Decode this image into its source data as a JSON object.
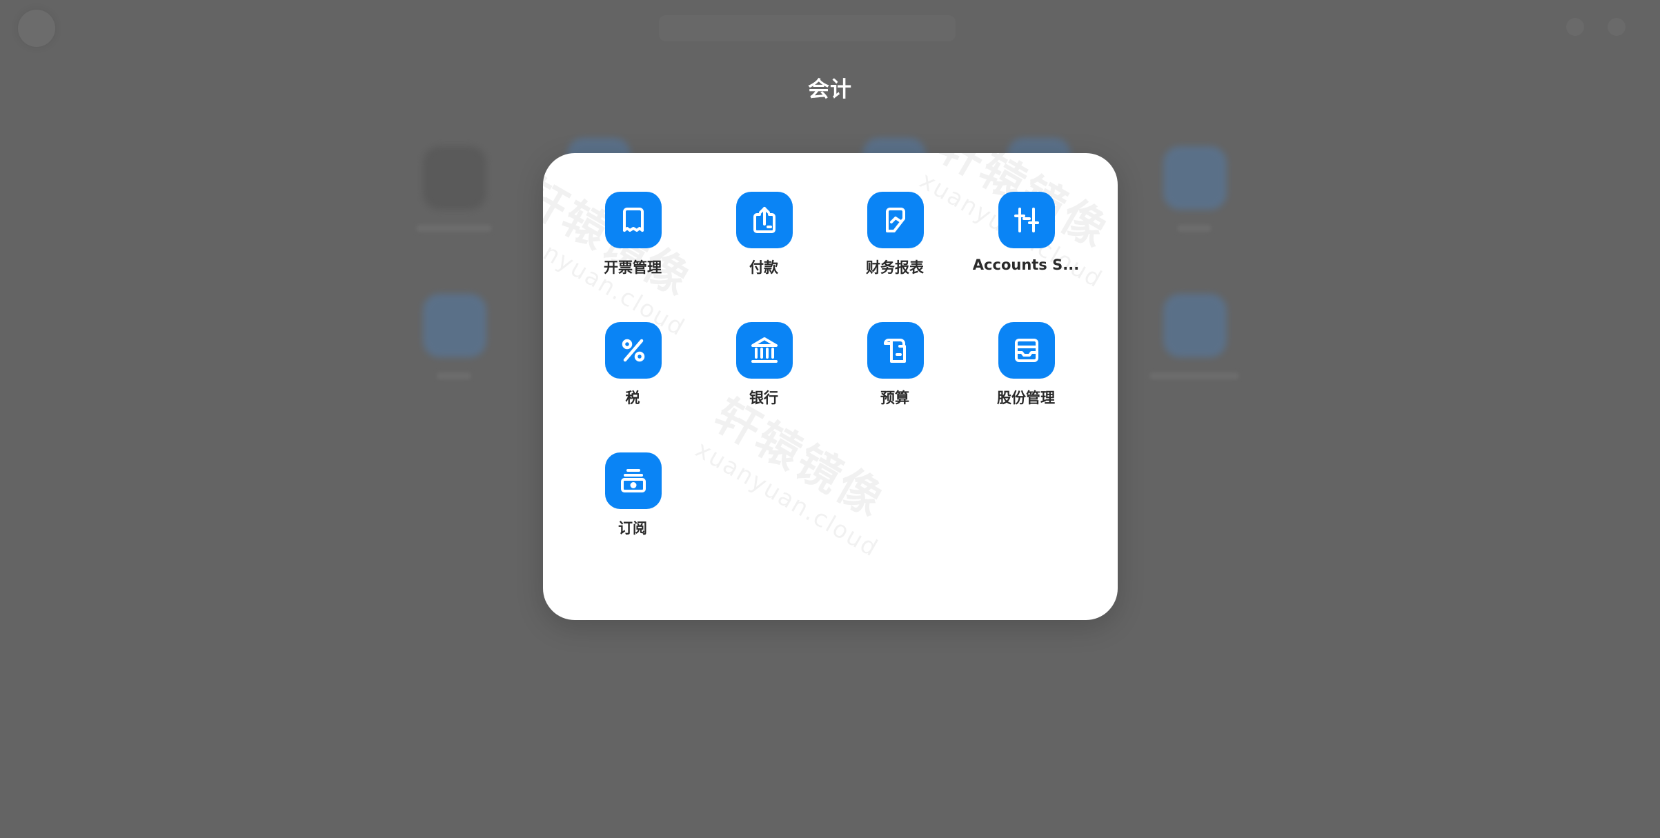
{
  "folder": {
    "title": "会计",
    "apps": [
      {
        "label": "开票管理",
        "icon": "receipt-icon"
      },
      {
        "label": "付款",
        "icon": "upload-payment-icon"
      },
      {
        "label": "财务报表",
        "icon": "financial-report-icon"
      },
      {
        "label": "Accounts S...",
        "icon": "adjustment-sliders-icon"
      },
      {
        "label": "税",
        "icon": "percent-icon"
      },
      {
        "label": "银行",
        "icon": "bank-icon"
      },
      {
        "label": "预算",
        "icon": "budget-scroll-icon"
      },
      {
        "label": "股份管理",
        "icon": "archive-box-icon"
      },
      {
        "label": "订阅",
        "icon": "subscription-icon"
      }
    ]
  },
  "watermark": {
    "text_cn": "轩辕镜像",
    "text_en": "xuanyuan.cloud"
  },
  "colors": {
    "accent": "#0a84f5",
    "backdrop": "#646464",
    "panel": "#ffffff"
  }
}
